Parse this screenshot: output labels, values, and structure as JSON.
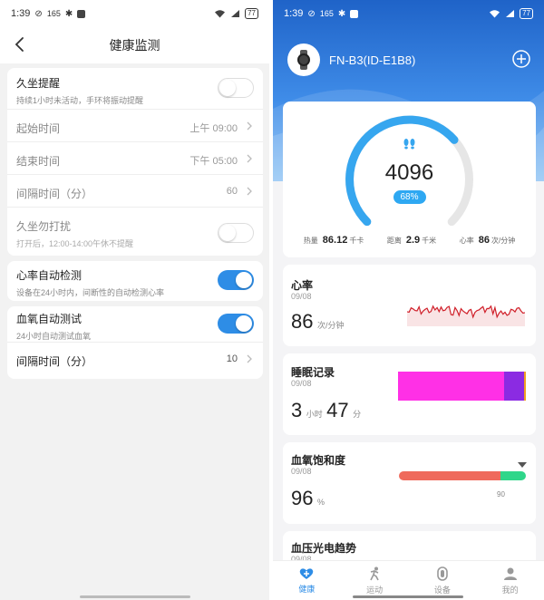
{
  "left": {
    "status": {
      "time": "1:39",
      "speed": "165",
      "battery": "77"
    },
    "title": "健康监测",
    "sedentary": {
      "title": "久坐提醒",
      "subtitle": "持续1小时未活动，手环将振动提醒",
      "enabled": false
    },
    "start_time": {
      "label": "起始时间",
      "value": "上午 09:00"
    },
    "end_time": {
      "label": "结束时间",
      "value": "下午 05:00"
    },
    "interval": {
      "label": "间隔时间（分）",
      "value": "60"
    },
    "dnd": {
      "title": "久坐勿打扰",
      "subtitle": "打开后，12:00-14:00午休不提醒",
      "enabled": false
    },
    "hr_auto": {
      "title": "心率自动检测",
      "subtitle": "设备在24小时内，间断性的自动检测心率",
      "enabled": true
    },
    "spo2_auto": {
      "title": "血氧自动测试",
      "subtitle": "24小时自动测试血氧",
      "enabled": true
    },
    "spo2_interval": {
      "label": "间隔时间（分）",
      "value": "10"
    }
  },
  "right": {
    "status": {
      "time": "1:39",
      "speed": "165",
      "battery": "77"
    },
    "device_name": "FN-B3(ID-E1B8)",
    "steps": "4096",
    "progress": 0.68,
    "progress_label": "68%",
    "stats": [
      {
        "label": "热量",
        "value": "86.12",
        "unit": "千卡"
      },
      {
        "label": "距离",
        "value": "2.9",
        "unit": "千米"
      },
      {
        "label": "心率",
        "value": "86",
        "unit": "次/分钟"
      }
    ],
    "heart": {
      "title": "心率",
      "date": "09/08",
      "value": "86",
      "unit": "次/分钟"
    },
    "sleep": {
      "title": "睡眠记录",
      "date": "09/08",
      "hours": "3",
      "hours_unit": "小时",
      "minutes": "47",
      "minutes_unit": "分"
    },
    "spo2": {
      "title": "血氧饱和度",
      "date": "09/08",
      "value": "96",
      "unit": "%",
      "scale_label": "90"
    },
    "bp": {
      "title": "血压光电趋势",
      "date": "09/08"
    },
    "nav": [
      {
        "label": "健康",
        "icon": "heart-icon"
      },
      {
        "label": "运动",
        "icon": "run-icon"
      },
      {
        "label": "设备",
        "icon": "watch-icon"
      },
      {
        "label": "我的",
        "icon": "person-icon"
      }
    ],
    "colors": {
      "accent": "#2e8de6",
      "deep_sleep": "#ff30e6",
      "light_sleep": "#8b2be2",
      "hr_line": "#d0202a",
      "spo2_low": "#ef6a5c",
      "spo2_ok": "#2fd68a"
    }
  }
}
